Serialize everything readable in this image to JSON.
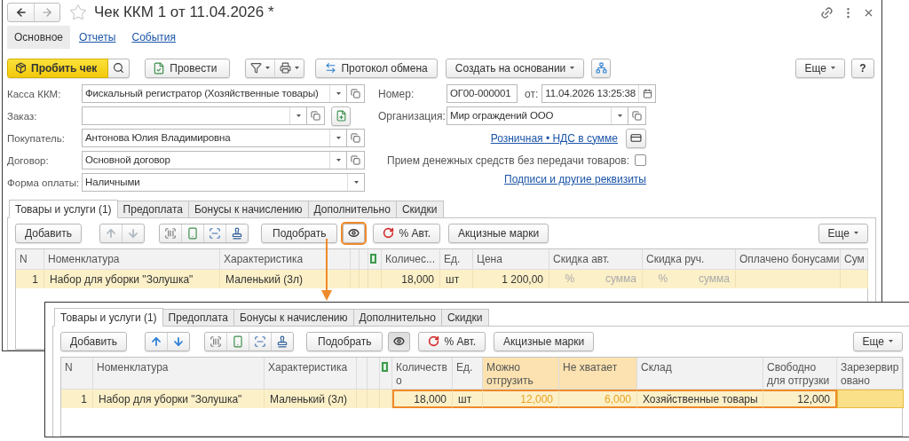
{
  "window": {
    "title": "Чек ККМ 1 от 11.04.2026 *"
  },
  "sections": [
    {
      "label": "Основное",
      "selected": true
    },
    {
      "label": "Отчеты",
      "selected": false
    },
    {
      "label": "События",
      "selected": false
    }
  ],
  "toolbar": {
    "print_receipt": "Пробить чек",
    "post": "Провести",
    "exchange_log": "Протокол обмена",
    "create_based_on": "Создать на основании",
    "more": "Еще",
    "help": "?"
  },
  "fields": [
    {
      "label": "Касса ККМ:",
      "value": "Фискальный регистратор (Хозяйственные товары)",
      "kind": "select_open"
    },
    {
      "label": "Заказ:",
      "kind": "select_open_fill"
    },
    {
      "label": "Покупатель:",
      "value": "Антонова Юлия Владимировна",
      "kind": "select_open"
    },
    {
      "label": "Договор:",
      "value": "Основной договор",
      "kind": "select_open"
    },
    {
      "label": "Форма оплаты:",
      "value": "Наличными",
      "kind": "select"
    }
  ],
  "number": {
    "label": "Номер:",
    "value": "ОГ00-000001"
  },
  "date": {
    "label": "от:",
    "value": "11.04.2026 13:25:38"
  },
  "organization": {
    "label": "Организация:",
    "value": "Мир ограждений ООО"
  },
  "price_link": "Розничная • НДС в сумме",
  "cash_without_goods": {
    "label": "Прием денежных средств без передачи товаров:",
    "checked": false
  },
  "details_link": "Подписи и другие реквизиты",
  "goods_panel": {
    "tabs": [
      {
        "label": "Товары и услуги (1)",
        "selected": true
      },
      {
        "label": "Предоплата",
        "selected": false
      },
      {
        "label": "Бонусы к начислению",
        "selected": false
      },
      {
        "label": "Дополнительно",
        "selected": false
      },
      {
        "label": "Скидки",
        "selected": false
      }
    ],
    "toolbar": {
      "add": "Добавить",
      "arrows_enabled": false,
      "pick": "Подобрать",
      "show_stock": {
        "pressed": false,
        "marked": true
      },
      "auto_discount": "% Авт.",
      "excise": "Акцизные марки",
      "more": "Еще"
    },
    "columns": [
      {
        "kind": "text",
        "label": "N"
      },
      {
        "kind": "text",
        "label": "Номенклатура"
      },
      {
        "kind": "text",
        "label": "Характеристика"
      },
      {
        "kind": "narrow"
      },
      {
        "kind": "narrow"
      },
      {
        "kind": "icon"
      },
      {
        "kind": "text",
        "label": "Количес..."
      },
      {
        "kind": "text",
        "label": "Ед."
      },
      {
        "kind": "text",
        "label": "Цена"
      },
      {
        "kind": "discount",
        "label": "Скидка авт."
      },
      {
        "kind": "discount",
        "label": "Скидка руч."
      },
      {
        "kind": "text",
        "label": "Оплачено бонусами"
      },
      {
        "kind": "text",
        "label": "Сум"
      }
    ],
    "rows": [
      {
        "selected": true,
        "cells": [
          {
            "text": "1"
          },
          {
            "text": "Набор для уборки \"Золушка\""
          },
          {
            "text": "Маленький (3л)"
          },
          "",
          "",
          "",
          {
            "text": "18,000"
          },
          {
            "text": "шт"
          },
          {
            "text": "1 200,00"
          },
          {
            "percent": "%",
            "amount": "сумма"
          },
          {
            "percent": "%",
            "amount": "сумма"
          }
        ]
      }
    ]
  },
  "inset": {
    "tabs": [
      {
        "label": "Товары и услуги (1)",
        "selected": true
      },
      {
        "label": "Предоплата",
        "selected": false
      },
      {
        "label": "Бонусы к начислению",
        "selected": false
      },
      {
        "label": "Дополнительно",
        "selected": false
      },
      {
        "label": "Скидки",
        "selected": false
      }
    ],
    "toolbar": {
      "add": "Добавить",
      "arrows_enabled": true,
      "pick": "Подобрать",
      "show_stock": {
        "pressed": true,
        "marked": false
      },
      "auto_discount": "% Авт.",
      "excise": "Акцизные марки",
      "more": "Еще"
    },
    "columns": [
      {
        "kind": "text",
        "label": "N",
        "highlight": false
      },
      {
        "kind": "text",
        "label": "Номенклатура",
        "highlight": false
      },
      {
        "kind": "text",
        "label": "Характеристика",
        "highlight": false
      },
      {
        "kind": "narrow"
      },
      {
        "kind": "narrow"
      },
      {
        "kind": "icon"
      },
      {
        "kind": "text",
        "label": "Количество",
        "highlight": false
      },
      {
        "kind": "text",
        "label": "Ед.",
        "highlight": false
      },
      {
        "kind": "text",
        "label": "Можно отгрузить",
        "highlight": true
      },
      {
        "kind": "text",
        "label": "Не хватает",
        "highlight": true
      },
      {
        "kind": "text",
        "label": "Склад",
        "highlight": false
      },
      {
        "kind": "text",
        "label": "Свободно для отгрузки",
        "highlight": false
      },
      {
        "kind": "text",
        "label": "Зарезервировано",
        "highlight": false
      }
    ],
    "rows": [
      {
        "selected": true,
        "cells": [
          {
            "text": "1",
            "marked": false,
            "focused": false
          },
          {
            "text": "Набор для уборки \"Золушка\"",
            "marked": false,
            "focused": false
          },
          {
            "text": "Маленький (3л)",
            "marked": false,
            "focused": false
          },
          "",
          "",
          "",
          {
            "text": "18,000",
            "marked": true,
            "focused": false
          },
          {
            "text": "шт",
            "marked": true,
            "focused": false
          },
          {
            "text": "12,000",
            "warning": true,
            "marked": true,
            "focused": false
          },
          {
            "text": "6,000",
            "warning": true,
            "marked": true,
            "focused": false
          },
          {
            "text": "Хозяйственные товары",
            "marked": true,
            "focused": false
          },
          {
            "text": "12,000",
            "marked": true,
            "focused": false
          },
          {
            "marked": false,
            "focused": true
          }
        ]
      }
    ]
  }
}
